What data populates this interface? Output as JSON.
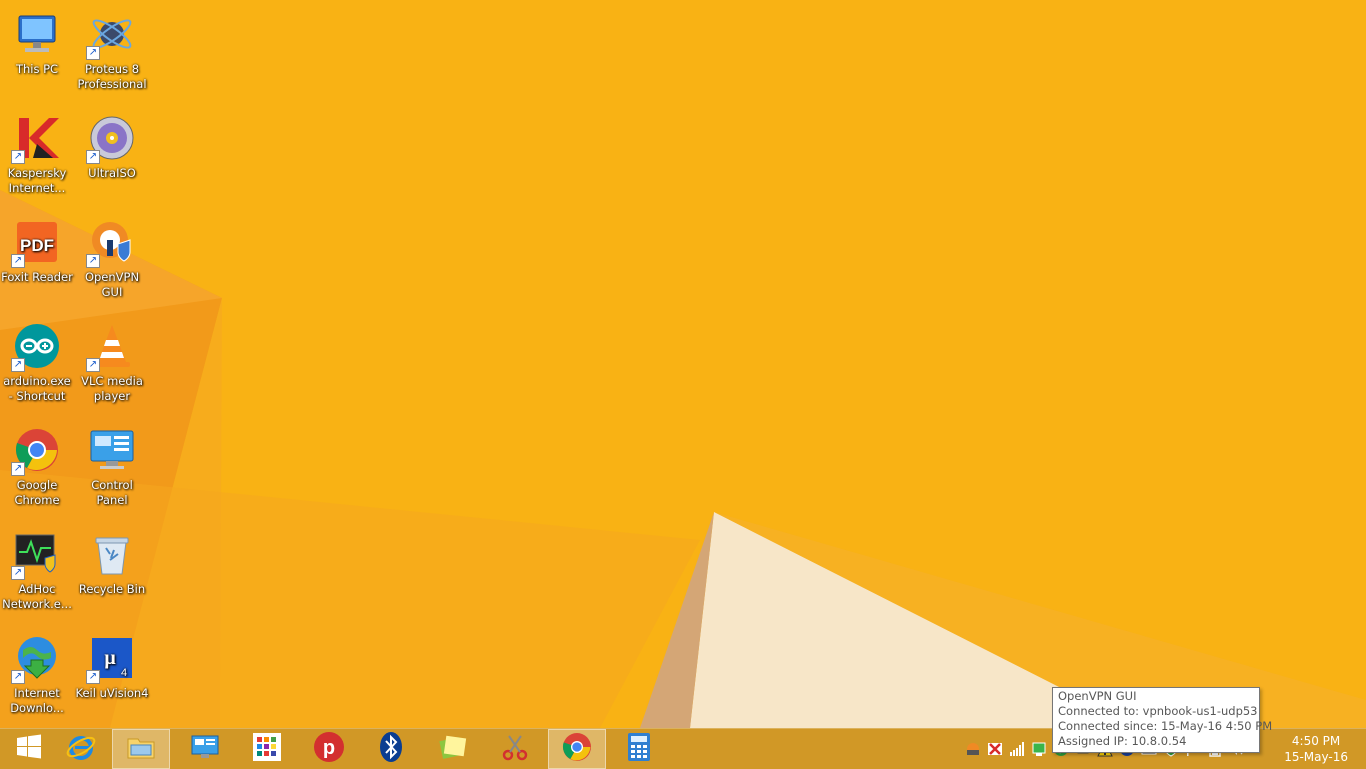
{
  "desktop": {
    "icons": [
      {
        "label": "This PC",
        "icon": "this-pc-icon",
        "shortcut": false
      },
      {
        "label": "Proteus 8 Professional",
        "icon": "proteus-icon",
        "shortcut": true
      },
      {
        "label": "Kaspersky Internet...",
        "icon": "kaspersky-icon",
        "shortcut": true
      },
      {
        "label": "UltraISO",
        "icon": "ultraiso-icon",
        "shortcut": true
      },
      {
        "label": "Foxit Reader",
        "icon": "foxit-reader-icon",
        "shortcut": true
      },
      {
        "label": "OpenVPN GUI",
        "icon": "openvpn-icon",
        "shortcut": true
      },
      {
        "label": "arduino.exe - Shortcut",
        "icon": "arduino-icon",
        "shortcut": true
      },
      {
        "label": "VLC media player",
        "icon": "vlc-icon",
        "shortcut": true
      },
      {
        "label": "Google Chrome",
        "icon": "chrome-icon",
        "shortcut": true
      },
      {
        "label": "Control Panel",
        "icon": "control-panel-icon",
        "shortcut": false
      },
      {
        "label": "AdHoc Network.e...",
        "icon": "adhoc-network-icon",
        "shortcut": true
      },
      {
        "label": "Recycle Bin",
        "icon": "recycle-bin-icon",
        "shortcut": false
      },
      {
        "label": "Internet Downlo...",
        "icon": "internet-download-manager-icon",
        "shortcut": true
      },
      {
        "label": "Keil uVision4",
        "icon": "keil-uvision-icon",
        "shortcut": true
      }
    ]
  },
  "taskbar": {
    "buttons": [
      {
        "name": "start-button",
        "icon": "windows-logo-icon",
        "active": false
      },
      {
        "name": "internet-explorer-button",
        "icon": "internet-explorer-icon",
        "active": false
      },
      {
        "name": "file-explorer-button",
        "icon": "file-explorer-icon",
        "active": true
      },
      {
        "name": "remote-desktop-button",
        "icon": "remote-desktop-icon",
        "active": false
      },
      {
        "name": "apps-grid-button",
        "icon": "apps-grid-icon",
        "active": false
      },
      {
        "name": "psiphon-button",
        "icon": "psiphon-icon",
        "active": false
      },
      {
        "name": "bluetooth-button",
        "icon": "bluetooth-icon",
        "active": false
      },
      {
        "name": "sticky-notes-button",
        "icon": "sticky-notes-icon",
        "active": false
      },
      {
        "name": "snipping-tool-button",
        "icon": "snipping-tool-icon",
        "active": false
      },
      {
        "name": "chrome-button",
        "icon": "chrome-icon",
        "active": true
      },
      {
        "name": "calculator-button",
        "icon": "calculator-icon",
        "active": false
      }
    ],
    "tray_icons": [
      "openvpn-tray-icon",
      "kaspersky-tray-icon",
      "signal-icon",
      "network-icon",
      "vpn-connected-icon",
      "usb-icon",
      "warning-icon",
      "help-icon",
      "keyboard-icon",
      "shield-icon",
      "flag-icon",
      "battery-icon",
      "speaker-icon"
    ],
    "clock": {
      "time": "4:50 PM",
      "date": "15-May-16"
    }
  },
  "tooltip": {
    "title": "OpenVPN GUI",
    "connected_to": "Connected to: vpnbook-us1-udp53",
    "connected_since": "Connected since: 15-May-16 4:50 PM",
    "assigned_ip": "Assigned IP: 10.8.0.54"
  }
}
